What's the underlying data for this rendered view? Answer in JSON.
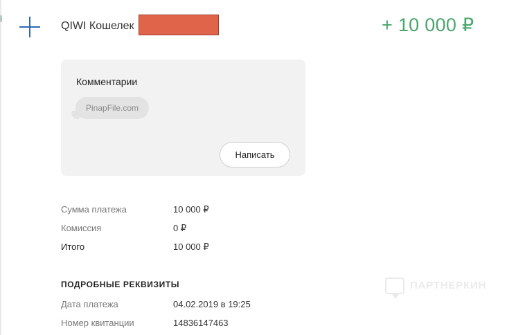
{
  "header": {
    "provider": "QIWI Кошелек",
    "amount": "+ 10 000 ₽"
  },
  "comments": {
    "title": "Комментарии",
    "message": "PinapFile.com",
    "write_button": "Написать"
  },
  "payment": {
    "rows": [
      {
        "label": "Сумма платежа",
        "value": "10 000 ₽"
      },
      {
        "label": "Комиссия",
        "value": "0 ₽"
      },
      {
        "label": "Итого",
        "value": "10 000 ₽"
      }
    ]
  },
  "details": {
    "title": "ПОДРОБНЫЕ РЕКВИЗИТЫ",
    "rows": [
      {
        "label": "Дата платежа",
        "value": "04.02.2019 в 19:25"
      },
      {
        "label": "Номер квитанции",
        "value": "14836147463"
      }
    ]
  },
  "watermark": {
    "text": "ПАРТНЕРКИН"
  },
  "colors": {
    "amount_green": "#4aa56b",
    "plus_blue": "#2f68b3",
    "redaction": "#e0644a"
  },
  "icons": {
    "expand": "plus-icon",
    "watermark": "chat-bubble-logo"
  }
}
